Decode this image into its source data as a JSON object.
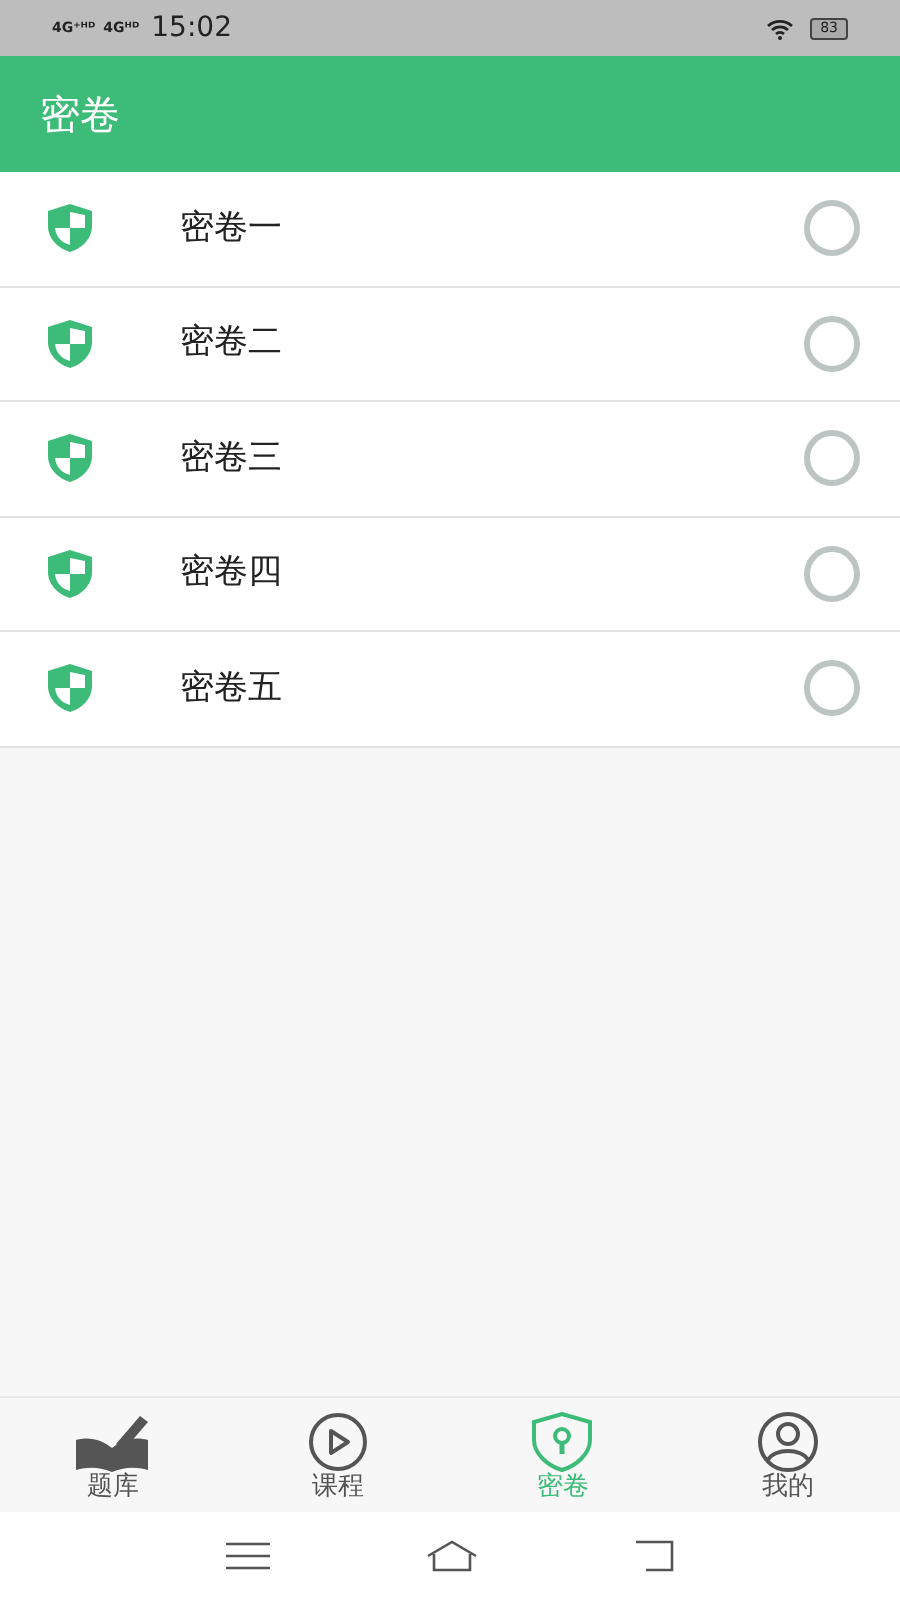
{
  "status_bar": {
    "signal_1": "4G⁺ᴴᴰ",
    "signal_2": "4Gᴴᴰ",
    "time": "15:02",
    "battery": "83"
  },
  "header": {
    "title": "密卷"
  },
  "papers": [
    {
      "name": "密卷一",
      "selected": false
    },
    {
      "name": "密卷二",
      "selected": false
    },
    {
      "name": "密卷三",
      "selected": false
    },
    {
      "name": "密卷四",
      "selected": false
    },
    {
      "name": "密卷五",
      "selected": false
    }
  ],
  "bottom_nav": [
    {
      "kind": "book",
      "label": "题库",
      "selected": false
    },
    {
      "kind": "play",
      "label": "课程",
      "selected": false
    },
    {
      "kind": "lock",
      "label": "密卷",
      "selected": true
    },
    {
      "kind": "user",
      "label": "我的",
      "selected": false
    }
  ]
}
